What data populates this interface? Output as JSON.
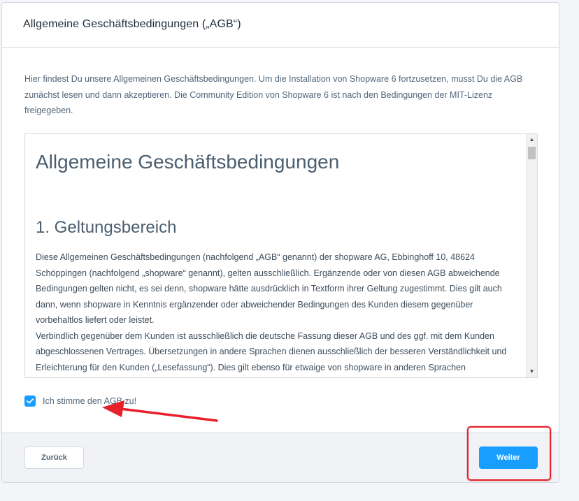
{
  "header": {
    "title": "Allgemeine Geschäftsbedingungen („AGB“)"
  },
  "intro": {
    "text": "Hier findest Du unsere Allgemeinen Geschäftsbedingungen. Um die Installation von Shopware 6 fortzusetzen, musst Du die AGB zunächst lesen und dann akzeptieren. Die Community Edition von Shopware 6 ist nach den Bedingungen der MIT-Lizenz freigegeben."
  },
  "terms": {
    "heading": "Allgemeine Geschäftsbedingungen",
    "section_heading": "1. Geltungsbereich",
    "body": "Diese Allgemeinen Geschäftsbedingungen (nachfolgend „AGB“ genannt) der shopware AG, Ebbinghoff 10, 48624 Schöppingen (nachfolgend „shopware“ genannt), gelten ausschließlich. Ergänzende oder von diesen AGB abweichende Bedingungen gelten nicht, es sei denn, shopware hätte ausdrücklich in Textform ihrer Geltung zugestimmt. Dies gilt auch dann, wenn shopware in Kenntnis ergänzender oder abweichender Bedingungen des Kunden diesem gegenüber vorbehaltlos liefert oder leistet.\nVerbindlich gegenüber dem Kunden ist ausschließlich die deutsche Fassung dieser AGB und des ggf. mit dem Kunden abgeschlossenen Vertrages. Übersetzungen in andere Sprachen dienen ausschließlich der besseren Verständlichkeit und Erleichterung für den Kunden („Lesefassung“). Dies gilt ebenso für etwaige von shopware in anderen Sprachen"
  },
  "consent": {
    "checked": true,
    "label": "Ich stimme den AGB zu!"
  },
  "footer": {
    "back_label": "Zurück",
    "next_label": "Weiter"
  },
  "colors": {
    "primary": "#189eff",
    "annotation": "#e8202a"
  },
  "icons": {
    "checkbox": "checkmark-icon",
    "scroll_up": "arrow-up-icon",
    "scroll_down": "arrow-down-icon"
  }
}
